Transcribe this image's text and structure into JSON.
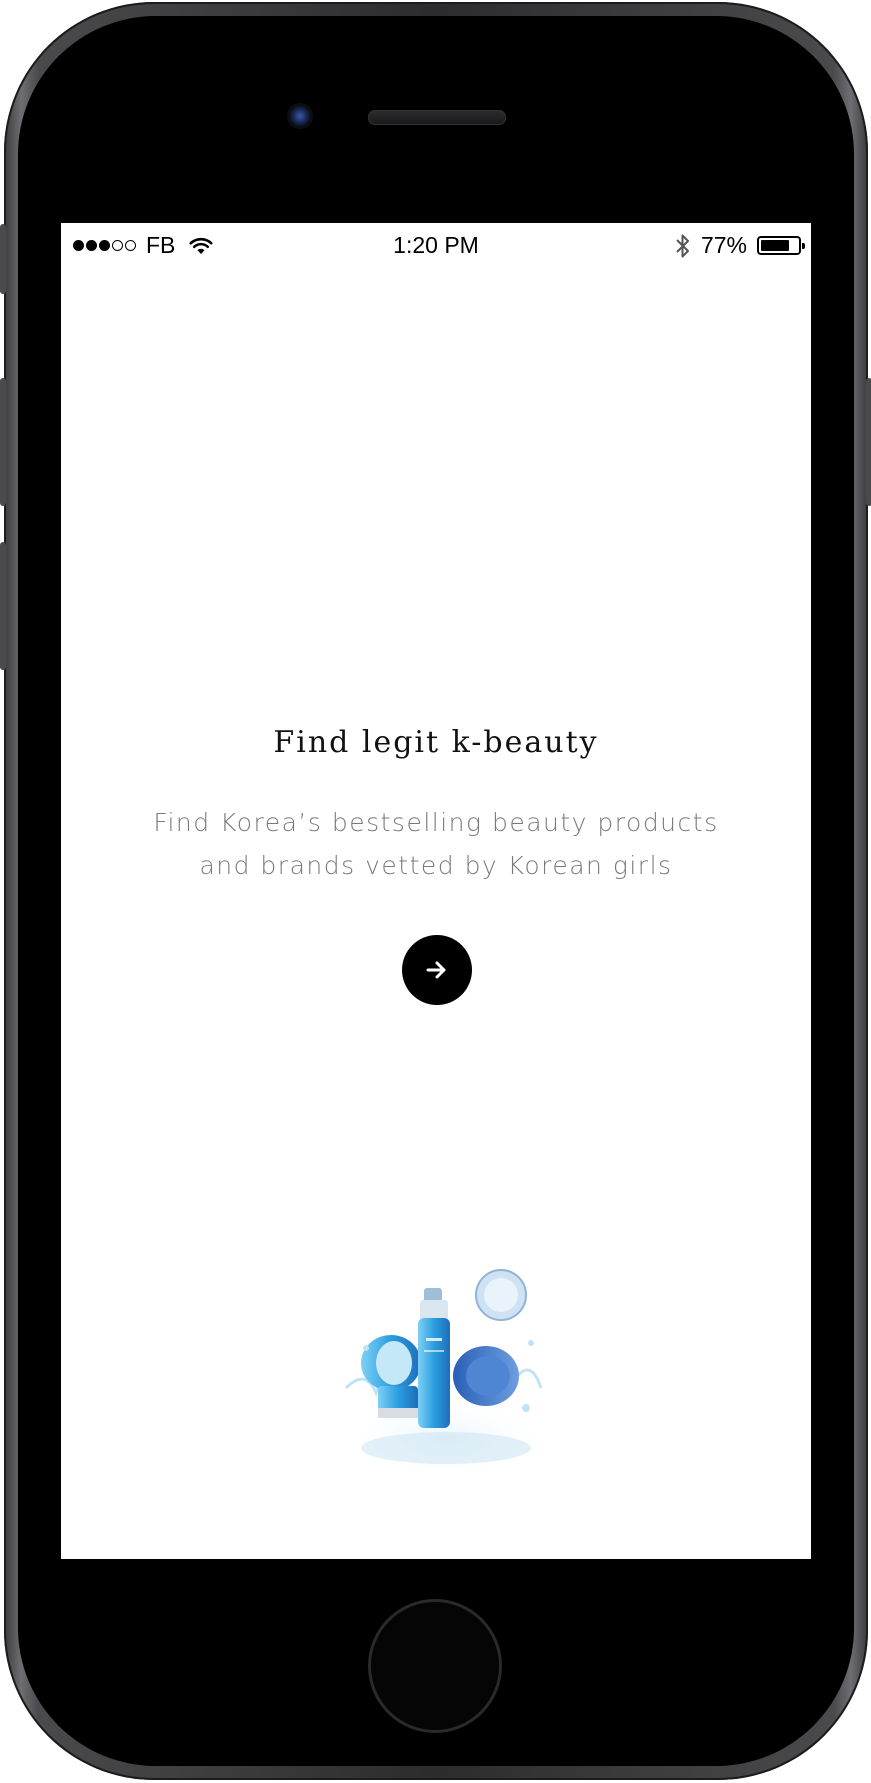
{
  "status_bar": {
    "signal_filled": 3,
    "signal_empty": 2,
    "carrier": "FB",
    "time": "1:20 PM",
    "bluetooth_icon": "bluetooth-icon",
    "battery_percent": "77%",
    "battery_level": 0.77
  },
  "onboarding": {
    "title": "Find legit k-beauty",
    "subtitle": "Find Korea’s bestselling beauty products\nand brands vetted by Korean girls",
    "next_icon": "arrow-right-icon"
  },
  "colors": {
    "accent": "#000000",
    "subtitle_text": "#7a7a7a",
    "product_blue": "#3aa7e6"
  }
}
